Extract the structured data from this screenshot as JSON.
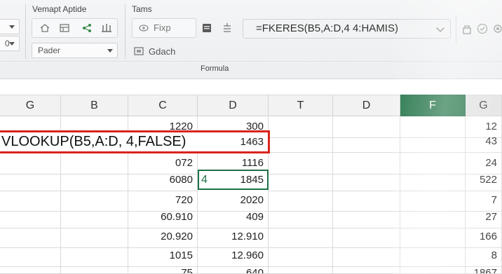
{
  "ribbon": {
    "group1_label": "Vemapt Aptide",
    "group2_label": "Tams",
    "dropdown_top_left": "",
    "dropdown_mid_left": "0",
    "dropdown_pader": "Pader",
    "fix_label": "Fixp",
    "gdach_label": "Gdach",
    "formula_group_label": "Formula",
    "formula_bar_value": "=FKERES(B5,A:D,4 4:HAMIS)"
  },
  "columns": [
    "G",
    "B",
    "C",
    "D",
    "T",
    "D",
    "F",
    "G"
  ],
  "selected_column": "F",
  "rows": [
    {
      "C": "1220",
      "D": "300",
      "G2": "12"
    },
    {
      "formula": "VLOOKUP(B5,A:D, 4,FALSE)",
      "D": "1463",
      "G2": "43"
    },
    {
      "C": "072",
      "D": "1116",
      "G2": "24"
    },
    {
      "C": "6080",
      "D": "1845",
      "active_prefix": "4",
      "G2": "522"
    },
    {
      "C": "720",
      "D": "2020",
      "G2": "7"
    },
    {
      "C": "60.910",
      "D": "409",
      "G2": "27"
    },
    {
      "C": "20.920",
      "D": "12.910",
      "G2": "166"
    },
    {
      "C": "1015",
      "D": "12.960",
      "G2": "8"
    },
    {
      "C": "75",
      "D": "640",
      "G2": "1867"
    }
  ],
  "colors": {
    "selected_header": "#1e7145",
    "formula_highlight": "#d9241c",
    "active_cell_border": "#1e7145"
  }
}
